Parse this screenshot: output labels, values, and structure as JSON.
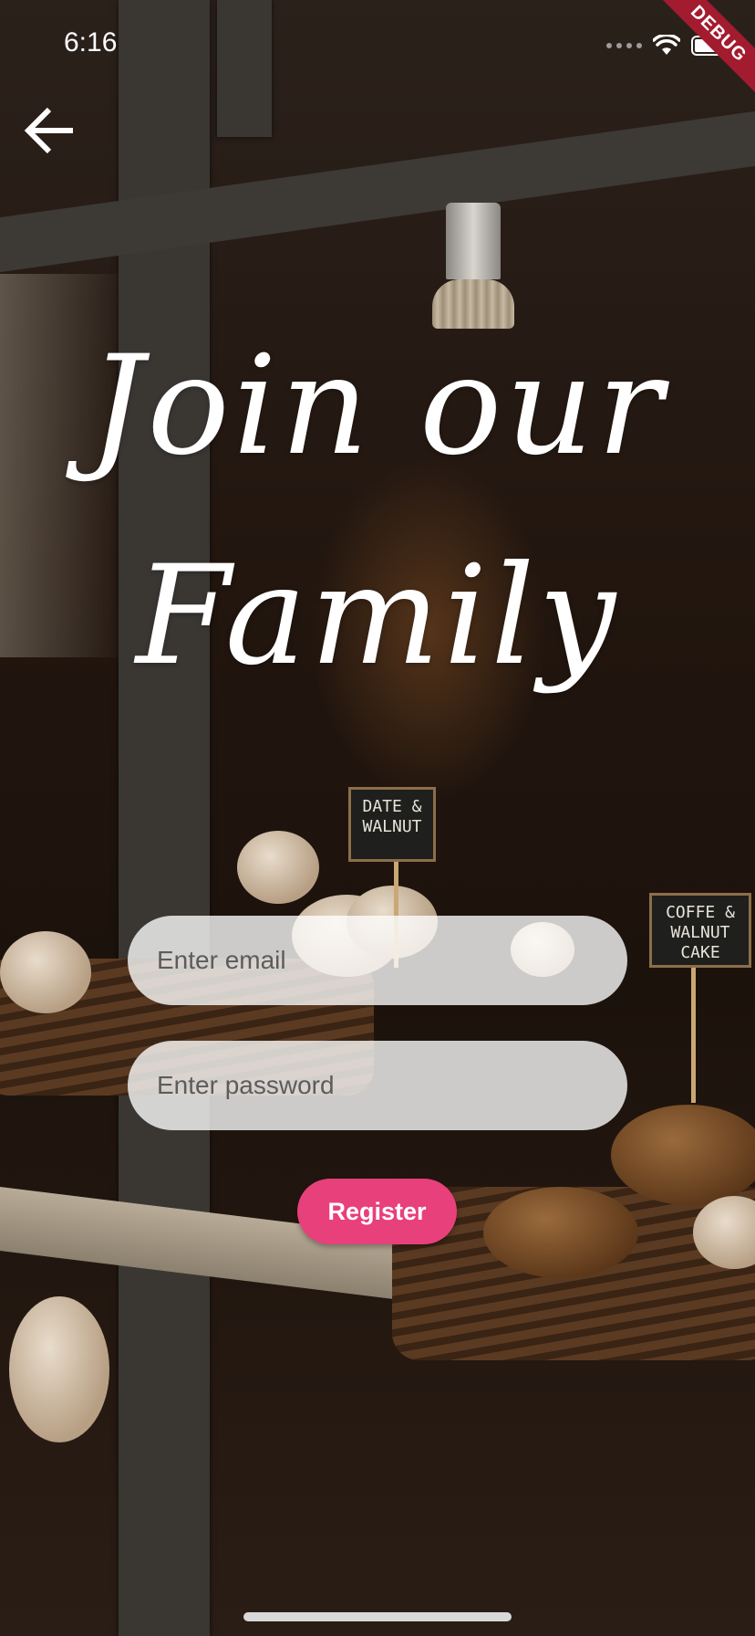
{
  "status_bar": {
    "time": "6:16",
    "debug_label": "DEBUG"
  },
  "background": {
    "signs": [
      "DATE & WALNUT",
      "COFFE & WALNUT CAKE"
    ]
  },
  "header": {
    "back_icon": "arrow-left-icon"
  },
  "hero": {
    "line1": "Join our",
    "line2": "Family"
  },
  "form": {
    "email_placeholder": "Enter email",
    "email_value": "",
    "password_placeholder": "Enter password",
    "password_value": "",
    "register_label": "Register"
  },
  "colors": {
    "accent": "#E8407A",
    "field_bg": "#FFFFFFC7",
    "debug_banner": "#A31B2E"
  }
}
